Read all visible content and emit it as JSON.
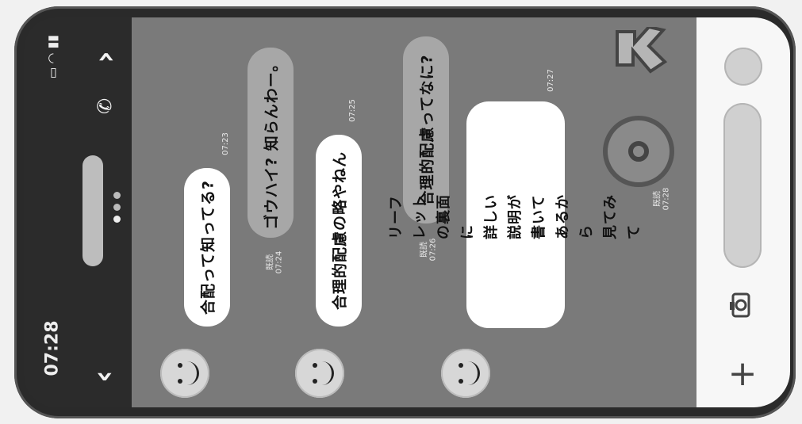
{
  "status": {
    "time": "07:28",
    "icons": [
      "signal-icon",
      "wifi-icon",
      "battery-icon"
    ]
  },
  "header": {
    "back_icon": "chevron-down-icon",
    "menu_icon": "chevron-up-icon",
    "call_icon": "phone-icon"
  },
  "chat": {
    "messages": [
      {
        "side": "left",
        "text": "合配って知ってる?",
        "meta": "07:23"
      },
      {
        "side": "right",
        "text": "ゴウハイ? 知らんわー。",
        "meta": "既読\n07:24"
      },
      {
        "side": "left",
        "text": "合理的配慮の略やねん",
        "meta": "07:25"
      },
      {
        "side": "right",
        "text": "合理的配慮ってなに?",
        "meta": "既読\n07:26"
      },
      {
        "side": "left",
        "text": "リーフレットの裏面に\n詳しい説明が書いてあるから\n見てみて",
        "meta": "07:27"
      },
      {
        "side": "right",
        "sticker": "OK",
        "meta": "既読\n07:28"
      }
    ]
  },
  "input": {
    "plus_icon": "plus-icon",
    "camera_icon": "camera-icon",
    "mic_icon": "circle-icon"
  }
}
